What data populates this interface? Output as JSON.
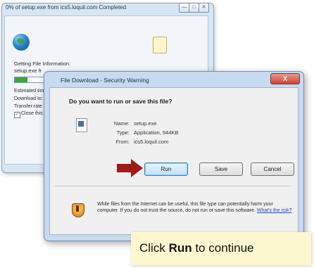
{
  "background_window": {
    "title": "0% of setup.exe from ics5.loquil.com Completed",
    "caption_buttons": [
      "—",
      "□",
      "✕"
    ],
    "status": "Getting File Information:",
    "file": "setup.exe fr",
    "progress_percent": 0.25,
    "labels": [
      "Estimated tim",
      "Download to:",
      "Transfer rate"
    ],
    "close_checkbox_label": "Close this"
  },
  "dialog": {
    "title": "File Download - Security Warning",
    "close_label": "X",
    "question": "Do you want to run or save this file?",
    "name_key": "Name:",
    "name_value": "setup.exe",
    "type_key": "Type:",
    "type_value": "Application, 544KB",
    "from_key": "From:",
    "from_value": "ics5.loquil.com",
    "buttons": {
      "run": "Run",
      "save": "Save",
      "cancel": "Cancel"
    },
    "warning_text": "While files from the Internet can be useful, this file type can potentially harm your computer. If you do not trust the source, do not run or save this software. ",
    "warning_link": "What's the risk?"
  },
  "callout": {
    "prefix": "Click ",
    "bold": "Run",
    "suffix": " to continue"
  },
  "colors": {
    "arrow": "#9e1b1b",
    "callout_bg": "#fdf7cf",
    "progress": "#3ea336"
  },
  "icons": [
    "globe-icon",
    "document-icon",
    "shield-warning-icon",
    "file-icon",
    "arrow-icon"
  ]
}
